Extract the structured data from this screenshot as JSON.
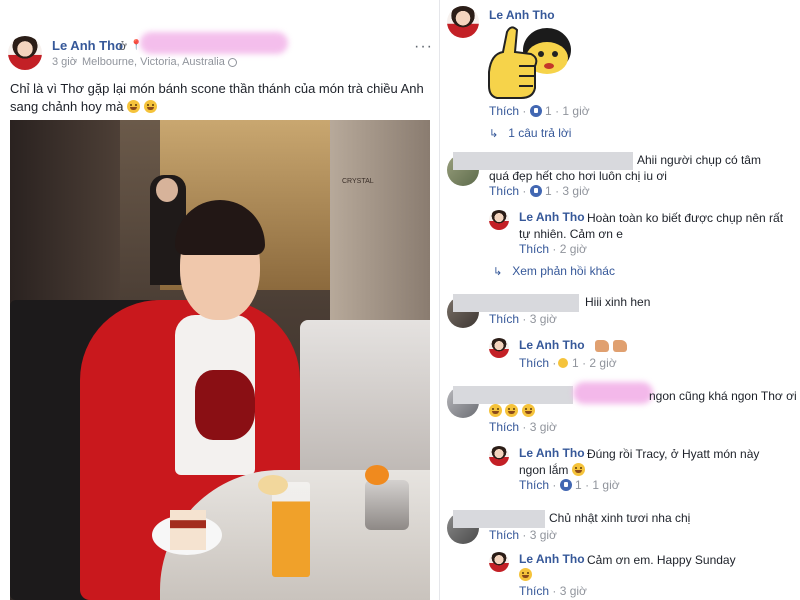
{
  "post": {
    "author": "Le Anh Tho",
    "at": "ở",
    "time": "3 giờ",
    "place": "Melbourne, Victoria, Australia",
    "dot": "·",
    "text": "Chỉ là vì Thơ gặp lại món bánh scone thần thánh của món trà chiều Anh sang chảnh hoy mà",
    "more": "···",
    "photo_sign": "CRYSTAL"
  },
  "comments": {
    "c1": {
      "author": "Le Anh Tho",
      "like": "Thích",
      "dot": "·",
      "count": "1",
      "time": "1 giờ",
      "replies": "1 câu trả lời"
    },
    "c2": {
      "text_line1": "Ahii người chụp có tâm",
      "text_line2": "quá đẹp hết cho hơi luôn chị iu ơi",
      "like": "Thích",
      "dot": "·",
      "count": "1",
      "time": "3 giờ"
    },
    "r2": {
      "author": "Le Anh Tho",
      "text": "Hoàn toàn ko biết được chụp nên rất tự nhiên. Cảm ơn e",
      "like": "Thích",
      "dot": "·",
      "time": "2 giờ",
      "more_replies": "Xem phản hồi khác"
    },
    "c3": {
      "text": "Hiii xinh hen",
      "like": "Thích",
      "dot": "·",
      "time": "3 giờ"
    },
    "r3": {
      "author": "Le Anh Tho",
      "like": "Thích",
      "dot": "·",
      "count": "1",
      "time": "2 giờ"
    },
    "c4": {
      "text_partial": "ngon cũng khá ngon Thơ ơi",
      "like": "Thích",
      "dot": "·",
      "time": "3 giờ"
    },
    "r4": {
      "author": "Le Anh Tho",
      "text": "Đúng rồi Tracy, ở Hyatt món này ngon lắm",
      "like": "Thích",
      "dot": "·",
      "count": "1",
      "time": "1 giờ"
    },
    "c5": {
      "text": "Chủ nhật xinh tươi nha chị",
      "like": "Thích",
      "dot": "·",
      "time": "3 giờ"
    },
    "r5": {
      "author": "Le Anh Tho",
      "text": "Cảm ơn em. Happy Sunday",
      "like": "Thích",
      "dot": "·",
      "time": "3 giờ"
    }
  }
}
